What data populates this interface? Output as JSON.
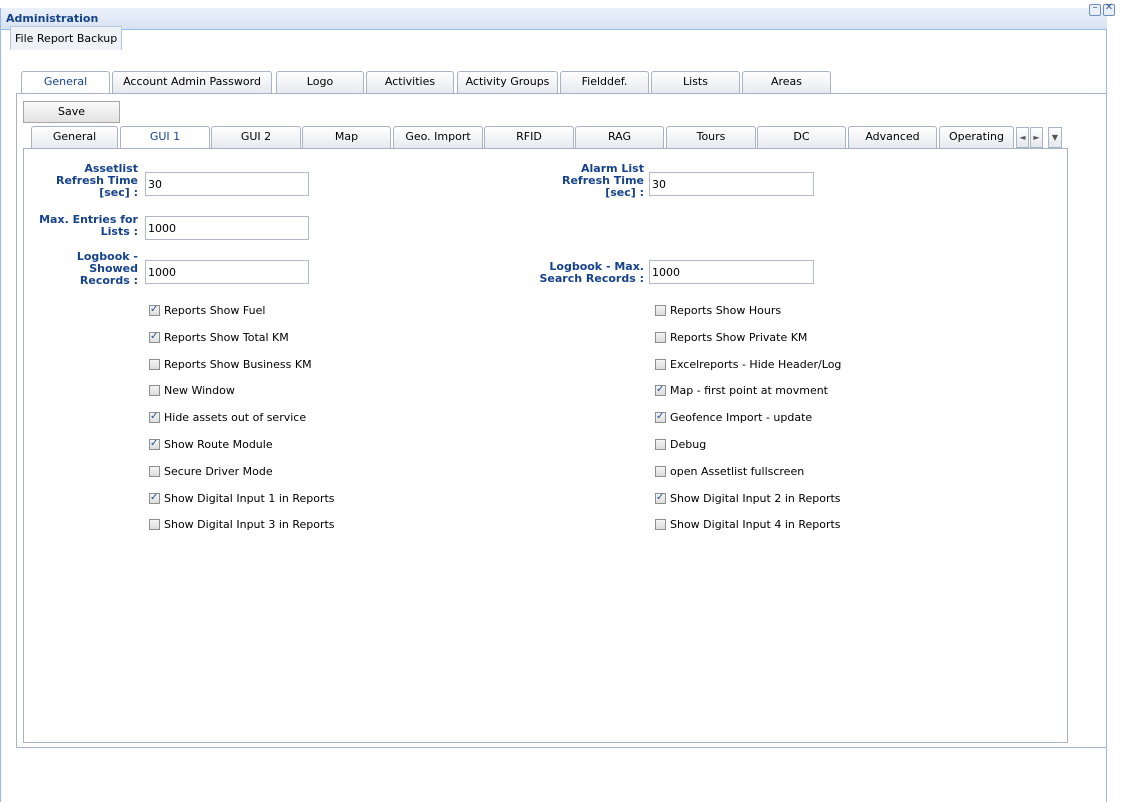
{
  "window": {
    "title": "Administration",
    "min_icon": "minimize-icon",
    "close_icon": "close-icon"
  },
  "top_tab": "File Report Backup",
  "main_tabs": [
    "General",
    "Account Admin Password",
    "Logo",
    "Activities",
    "Activity Groups",
    "Fielddef.",
    "Lists",
    "Areas"
  ],
  "main_active": "General",
  "save_label": "Save",
  "sub_tabs": [
    "General",
    "GUI 1",
    "GUI 2",
    "Map",
    "Geo. Import",
    "RFID",
    "RAG",
    "Tours",
    "DC",
    "Advanced",
    "Operating"
  ],
  "sub_active": "GUI 1",
  "scroll": {
    "left": "◄",
    "right": "►",
    "menu": "▼"
  },
  "fields": {
    "assetlist_label": [
      "Assetlist",
      "Refresh Time",
      "[sec] :"
    ],
    "assetlist_value": "30",
    "alarm_label": [
      "Alarm List",
      "Refresh Time",
      "[sec] :"
    ],
    "alarm_value": "30",
    "maxentries_label": [
      "Max. Entries for",
      "Lists :"
    ],
    "maxentries_value": "1000",
    "logbook_label": [
      "Logbook -",
      "Showed",
      "Records :"
    ],
    "logbook_value": "1000",
    "logbookmax_label": [
      "Logbook - Max.",
      "Search Records :"
    ],
    "logbookmax_value": "1000"
  },
  "checkboxes_left": [
    {
      "label": "Reports Show Fuel",
      "checked": true
    },
    {
      "label": "Reports Show Total KM",
      "checked": true
    },
    {
      "label": "Reports Show Business KM",
      "checked": false
    },
    {
      "label": "New Window",
      "checked": false
    },
    {
      "label": "Hide assets out of service",
      "checked": true
    },
    {
      "label": "Show Route Module",
      "checked": true
    },
    {
      "label": "Secure Driver Mode",
      "checked": false
    },
    {
      "label": "Show Digital Input 1 in Reports",
      "checked": true
    },
    {
      "label": "Show Digital Input 3 in Reports",
      "checked": false
    }
  ],
  "checkboxes_right": [
    {
      "label": "Reports Show Hours",
      "checked": false
    },
    {
      "label": "Reports Show Private KM",
      "checked": false
    },
    {
      "label": "Excelreports - Hide Header/Log",
      "checked": false
    },
    {
      "label": "Map - first point at movment",
      "checked": true
    },
    {
      "label": "Geofence Import - update",
      "checked": true
    },
    {
      "label": "Debug",
      "checked": false
    },
    {
      "label": "open Assetlist fullscreen",
      "checked": false
    },
    {
      "label": "Show Digital Input 2 in Reports",
      "checked": true
    },
    {
      "label": "Show Digital Input 4 in Reports",
      "checked": false
    }
  ]
}
